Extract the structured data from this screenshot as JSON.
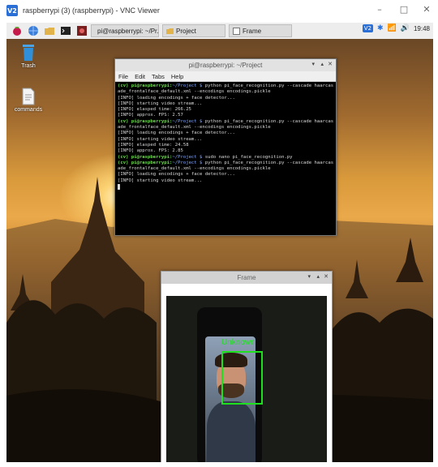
{
  "vnc": {
    "logo": "V2",
    "title": "raspberrypi (3) (raspberrypi) - VNC Viewer",
    "controls": {
      "minimize": "–",
      "maximize": "□",
      "close": "✕"
    }
  },
  "panel": {
    "taskbar": [
      {
        "label": "pi@raspberrypi: ~/Pr...",
        "icon": "terminal-icon"
      },
      {
        "label": "Project",
        "icon": "folder-icon"
      },
      {
        "label": "Frame",
        "icon": "window-icon"
      }
    ],
    "tray": {
      "vnc": "V2",
      "bluetooth": "✱",
      "wifi": "📶",
      "volume": "🔊"
    },
    "clock": "19:48"
  },
  "desktop": {
    "icons": [
      {
        "label": "Trash",
        "icon": "trash-icon"
      },
      {
        "label": "commands",
        "icon": "document-icon"
      }
    ]
  },
  "terminal": {
    "title": "pi@raspberrypi: ~/Project",
    "controls": {
      "minimize": "▾",
      "maximize": "▴",
      "close": "✕"
    },
    "menu": [
      "File",
      "Edit",
      "Tabs",
      "Help"
    ],
    "lines": [
      {
        "prompt": "(cv) pi@raspberrypi:",
        "path": "~/Project $",
        "text": " python pi_face_recognition.py --cascade haarcas"
      },
      {
        "text": "ade_frontalface_default.xml --encodings encodings.pickle"
      },
      {
        "text": "[INFO] loading encodings + face detector..."
      },
      {
        "text": "[INFO] starting video stream..."
      },
      {
        "text": "[INFO] elasped time: 266.25"
      },
      {
        "text": "[INFO] approx. FPS: 2.57"
      },
      {
        "prompt": "(cv) pi@raspberrypi:",
        "path": "~/Project $",
        "text": " python pi_face_recognition.py --cascade haarcas"
      },
      {
        "text": "ade_frontalface_default.xml --encodings encodings.pickle"
      },
      {
        "text": "[INFO] loading encodings + face detector..."
      },
      {
        "text": "[INFO] starting video stream..."
      },
      {
        "text": "[INFO] elasped time: 24.58"
      },
      {
        "text": "[INFO] approx. FPS: 2.85"
      },
      {
        "prompt": "(cv) pi@raspberrypi:",
        "path": "~/Project $",
        "text": " sudo nano pi_face_recognition.py"
      },
      {
        "prompt": "(cv) pi@raspberrypi:",
        "path": "~/Project $",
        "text": " python pi_face_recognition.py --cascade haarcas"
      },
      {
        "text": "ade_frontalface_default.xml --encodings encodings.pickle"
      },
      {
        "text": "[INFO] loading encodings + face detector..."
      },
      {
        "text": "[INFO] starting video stream..."
      }
    ]
  },
  "frame": {
    "title": "Frame",
    "controls": {
      "minimize": "▾",
      "maximize": "▴",
      "close": "✕"
    },
    "detection_label": "Unknown",
    "box_color": "#1ee01e"
  },
  "colors": {
    "prompt": "#6bdc4b",
    "path": "#7ea7ff",
    "terminal_bg": "#000000"
  }
}
